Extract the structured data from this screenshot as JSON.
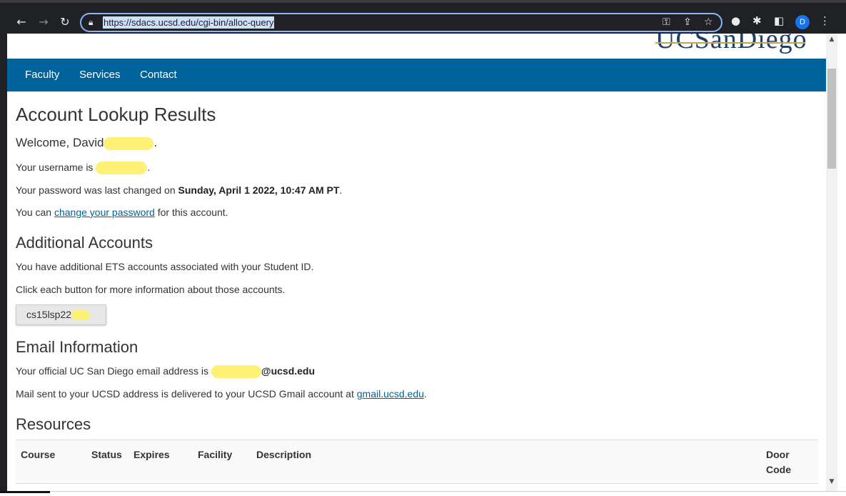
{
  "browser": {
    "url": "https://sdacs.ucsd.edu/cgi-bin/alloc-query",
    "profile_initial": "D",
    "icons": [
      "back-icon",
      "forward-icon",
      "reload-icon",
      "lock-icon",
      "key-icon",
      "share-icon",
      "star-icon",
      "extension-icon",
      "puzzle-icon",
      "sidepanel-icon",
      "profile-icon",
      "menu-icon"
    ]
  },
  "header": {
    "logo_text": "UCSanDiego"
  },
  "nav": {
    "items": [
      {
        "label": "Faculty"
      },
      {
        "label": "Services"
      },
      {
        "label": "Contact"
      }
    ]
  },
  "main": {
    "title": "Account Lookup Results",
    "welcome": "Welcome, David",
    "welcome_end": ".",
    "username_prefix": "Your username is",
    "username_end": ".",
    "pwd_prefix": "Your password was last changed on ",
    "pwd_date": "Sunday, April 1 2022, 10:47 AM PT",
    "pwd_end": ".",
    "change_prefix": "You can ",
    "change_link": "change your password",
    "change_suffix": " for this account."
  },
  "additional": {
    "title": "Additional Accounts",
    "line1": "You have additional ETS accounts associated with your Student ID.",
    "line2": "Click each button for more information about those accounts.",
    "account_button": "cs15lsp22"
  },
  "email": {
    "title": "Email Information",
    "line1_prefix": "Your official UC San Diego email address is",
    "domain": "@ucsd.edu",
    "line2_prefix": "Mail sent to your UCSD address is delivered to your UCSD Gmail account at ",
    "gmail_link": "gmail.ucsd.edu",
    "line2_end": "."
  },
  "resources": {
    "title": "Resources",
    "columns": [
      "Course",
      "Status",
      "Expires",
      "Facility",
      "Description",
      "Door Code"
    ]
  },
  "colors": {
    "nav_bg": "#00629b",
    "link": "#00629b",
    "redaction": "#fff176"
  }
}
